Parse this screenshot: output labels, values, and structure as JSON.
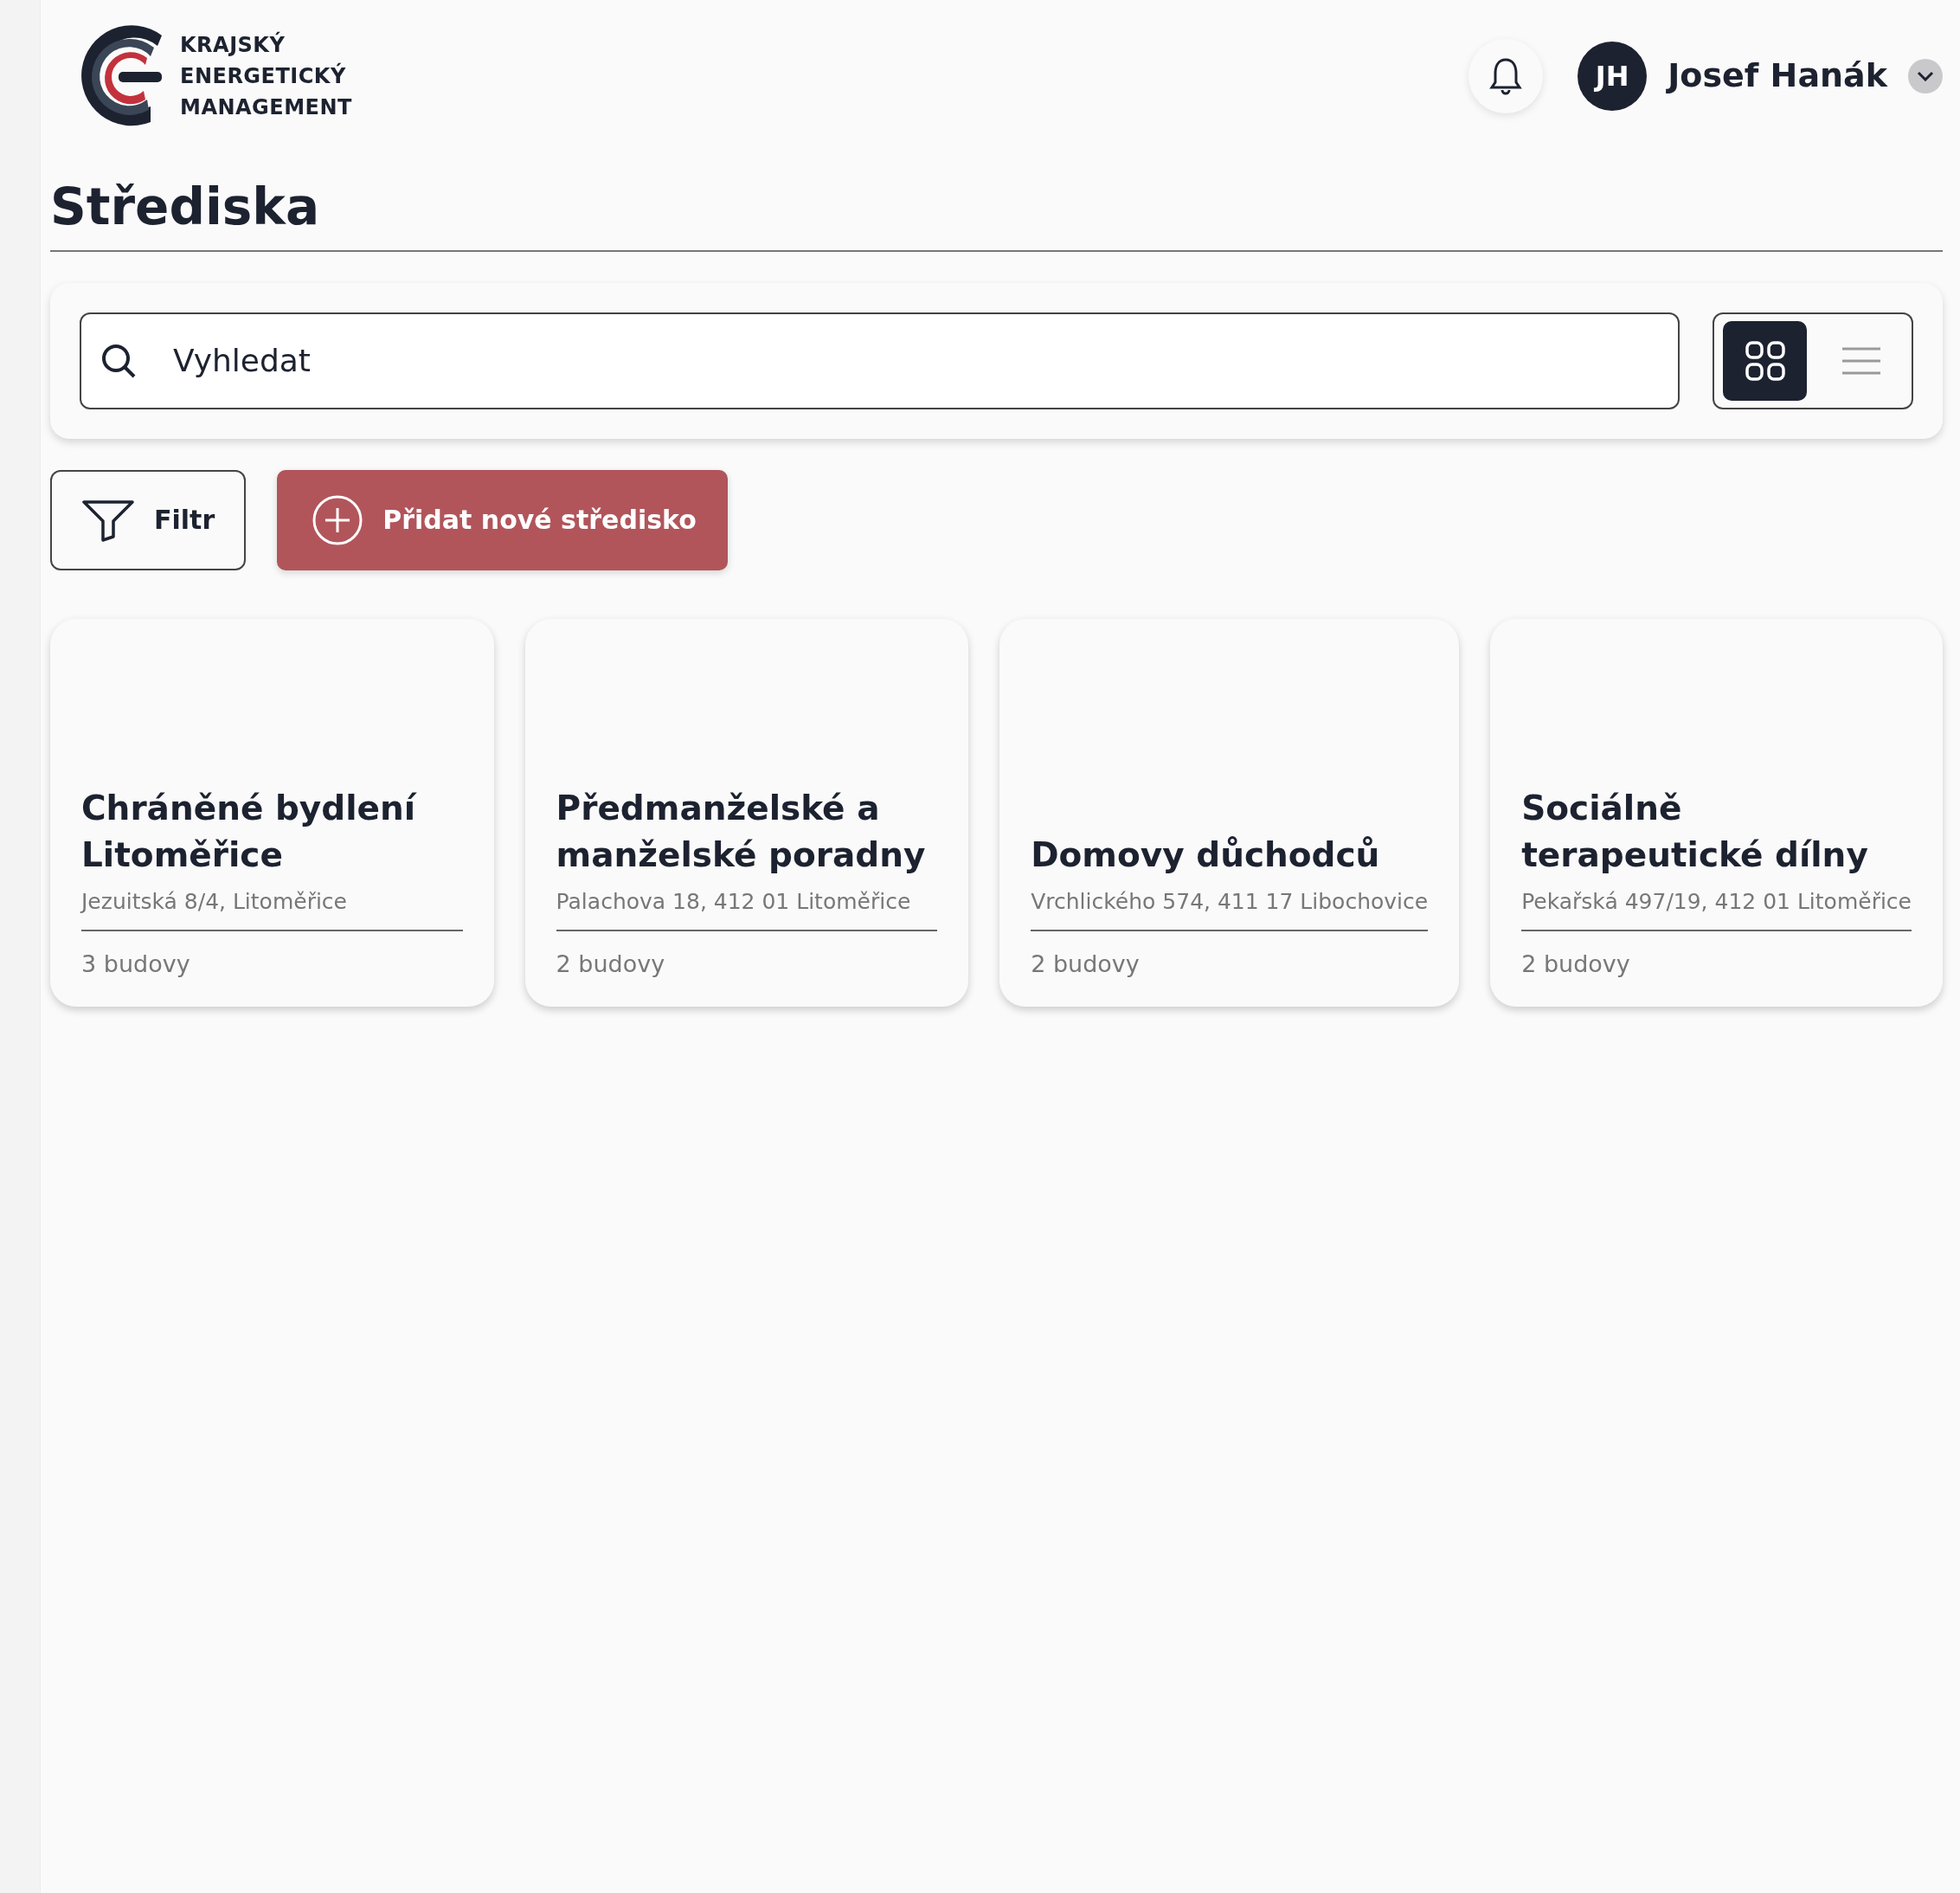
{
  "logo": {
    "lines": [
      "KRAJSKÝ",
      "ENERGETICKÝ",
      "MANAGEMENT"
    ]
  },
  "user": {
    "initials": "JH",
    "name": "Josef Hanák"
  },
  "page_title": "Střediska",
  "search": {
    "placeholder": "Vyhledat"
  },
  "view_modes": [
    {
      "kind": "grid",
      "selected": true
    },
    {
      "kind": "list",
      "selected": false
    }
  ],
  "buttons": [
    {
      "kind": "filter",
      "label": "Filtr"
    },
    {
      "kind": "add",
      "label": "Přidat nové středisko"
    }
  ],
  "centers": [
    {
      "title": "Chráněné bydlení Litoměřice",
      "address": "Jezuitská 8/4, Litoměřice",
      "buildings": "3 budovy"
    },
    {
      "title": "Předmanželské a manželské poradny",
      "address": "Palachova 18, 412 01 Litoměřice",
      "buildings": "2 budovy"
    },
    {
      "title": "Domovy důchodců",
      "address": "Vrchlického 574, 411 17 Libochovice",
      "buildings": "2 budovy"
    },
    {
      "title": "Sociálně terapeutické dílny",
      "address": "Pekařská 497/19, 412 01 Litoměřice",
      "buildings": "2 budovy"
    }
  ]
}
